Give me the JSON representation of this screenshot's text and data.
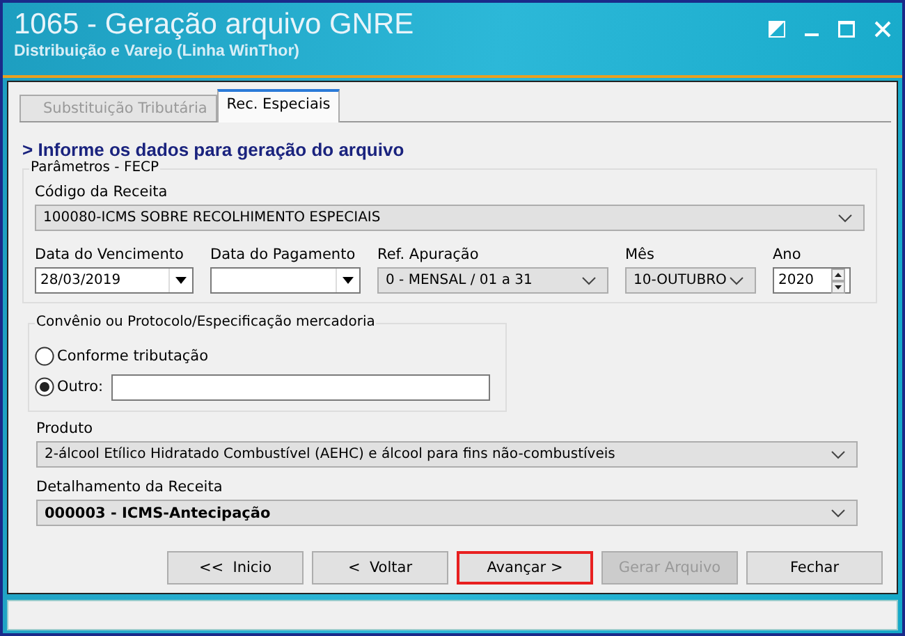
{
  "window": {
    "title": "1065 - Geração arquivo GNRE",
    "subtitle": "Distribuição e Varejo (Linha WinThor)"
  },
  "tabs": [
    {
      "label": "Substituição Tributária",
      "selected": false
    },
    {
      "label": "Rec. Especiais",
      "selected": true
    }
  ],
  "heading": "> Informe os dados para geração do arquivo",
  "parameters": {
    "legend": "Parâmetros - FECP",
    "code": {
      "label": "Código da Receita",
      "value": "100080-ICMS SOBRE RECOLHIMENTO ESPECIAIS"
    },
    "fields": [
      {
        "kind": "date",
        "label": "Data do Vencimento",
        "value": "28/03/2019"
      },
      {
        "kind": "date",
        "label": "Data do Pagamento"
      },
      {
        "kind": "combo",
        "label": "Ref. Apuração",
        "value": "0 - MENSAL / 01 a 31"
      },
      {
        "kind": "combo",
        "label": "Mês",
        "value": "10-OUTUBRO"
      },
      {
        "kind": "spin",
        "label": "Ano",
        "value": "2020"
      }
    ]
  },
  "agreement": {
    "legend": "Convênio ou Protocolo/Especificação mercadoria",
    "options": [
      {
        "kind": "radio",
        "label": "Conforme tributação",
        "selected": false
      },
      {
        "kind": "radio_input",
        "label": "Outro:",
        "selected": true
      }
    ]
  },
  "product": {
    "label": "Produto",
    "value": "2-álcool Etílico Hidratado Combustível (AEHC) e álcool para fins não-combustíveis"
  },
  "detail": {
    "label": "Detalhamento da Receita",
    "value": "000003 - ICMS-Antecipação"
  },
  "buttons": [
    {
      "label": "<<  Inicio",
      "disabled": false,
      "highlighted": false
    },
    {
      "label": "<  Voltar",
      "disabled": false,
      "highlighted": false
    },
    {
      "label": "Avançar >",
      "disabled": false,
      "highlighted": true
    },
    {
      "label": "Gerar Arquivo",
      "disabled": true,
      "highlighted": false
    },
    {
      "label": "Fechar",
      "disabled": false,
      "highlighted": false
    }
  ]
}
